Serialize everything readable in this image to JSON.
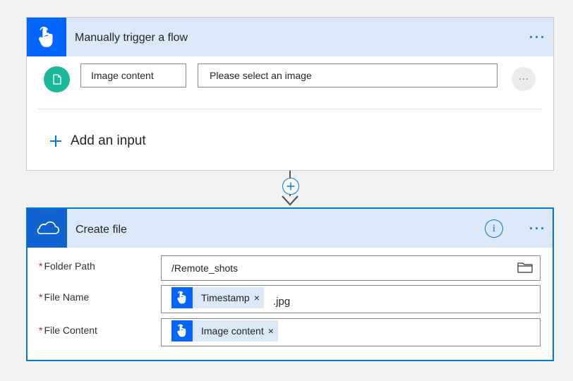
{
  "trigger": {
    "title": "Manually trigger a flow",
    "input_name": "Image content",
    "input_description": "Please select an image",
    "add_input_label": "Add an input",
    "icon": "touch-hand-icon"
  },
  "action": {
    "title": "Create file",
    "icon": "onedrive-cloud-icon",
    "fields": {
      "folder_path": {
        "label": "Folder Path",
        "value": "/Remote_shots"
      },
      "file_name": {
        "label": "File Name",
        "token": "Timestamp",
        "suffix": ".jpg"
      },
      "file_content": {
        "label": "File Content",
        "token": "Image content"
      }
    },
    "required_marker": "*",
    "remove_token_glyph": "×"
  },
  "colors": {
    "accent": "#0078d4",
    "header_bg": "#dae8f8",
    "trigger_icon_bg": "#0066ff",
    "file_circle": "#1cb89a",
    "required": "#a4262c"
  }
}
